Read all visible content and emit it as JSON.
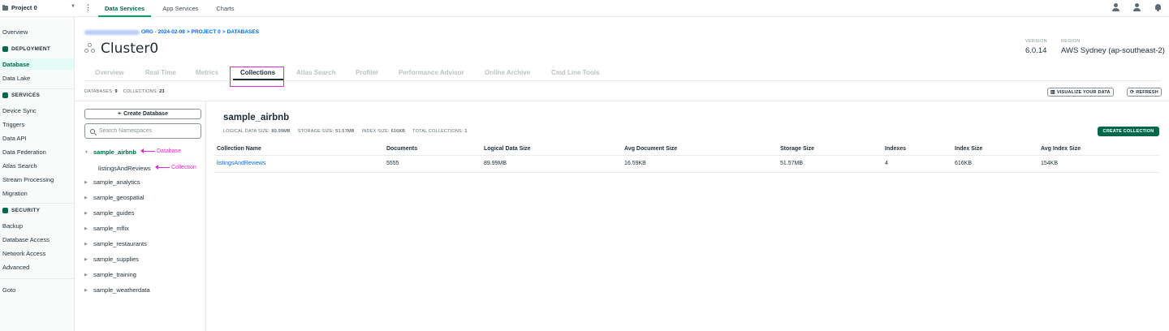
{
  "topbar": {
    "project": "Project 0",
    "tabs": [
      "Data Services",
      "App Services",
      "Charts"
    ],
    "active_tab": "Data Services"
  },
  "leftnav": {
    "overview": "Overview",
    "deployment_header": "DEPLOYMENT",
    "database": "Database",
    "data_lake": "Data Lake",
    "services_header": "SERVICES",
    "device_sync": "Device Sync",
    "triggers": "Triggers",
    "data_api": "Data API",
    "data_federation": "Data Federation",
    "atlas_search": "Atlas Search",
    "stream_processing": "Stream Processing",
    "migration": "Migration",
    "security_header": "SECURITY",
    "backup": "Backup",
    "database_access": "Database Access",
    "network_access": "Network Access",
    "advanced": "Advanced",
    "goto": "Goto"
  },
  "breadcrumb": {
    "org": "ORG - 2024-02-08",
    "sep1": ">",
    "project": "PROJECT 0",
    "sep2": ">",
    "databases": "DATABASES"
  },
  "cluster": {
    "name": "Cluster0",
    "version_label": "VERSION",
    "version": "6.0.14",
    "region_label": "REGION",
    "region": "AWS Sydney (ap-southeast-2)"
  },
  "tabs": [
    "Overview",
    "Real Time",
    "Metrics",
    "Collections",
    "Atlas Search",
    "Profiler",
    "Performance Advisor",
    "Online Archive",
    "Cmd Line Tools"
  ],
  "active_tab": "Collections",
  "counts": {
    "databases_label": "DATABASES:",
    "databases": "9",
    "collections_label": "COLLECTIONS:",
    "collections": "23"
  },
  "actions": {
    "visualize": "VISUALIZE YOUR DATA",
    "refresh": "REFRESH"
  },
  "db_panel": {
    "create_database": "Create Database",
    "search_placeholder": "Search Namespaces",
    "databases": [
      "sample_airbnb",
      "sample_analytics",
      "sample_geospatial",
      "sample_guides",
      "sample_mflix",
      "sample_restaurants",
      "sample_supplies",
      "sample_training",
      "sample_weatherdata"
    ],
    "expanded": "sample_airbnb",
    "collections": [
      "listingsAndReviews"
    ],
    "annotations": {
      "database": "Database",
      "collection": "Collection"
    }
  },
  "main": {
    "title": "sample_airbnb",
    "stats": {
      "logical_label": "LOGICAL DATA SIZE:",
      "logical": "89.99MB",
      "storage_label": "STORAGE SIZE:",
      "storage": "51.57MB",
      "index_label": "INDEX SIZE:",
      "index": "616KB",
      "total_label": "TOTAL COLLECTIONS:",
      "total": "1"
    },
    "create_collection": "CREATE COLLECTION",
    "table": {
      "headers": [
        "Collection Name",
        "Documents",
        "Logical Data Size",
        "Avg Document Size",
        "Storage Size",
        "Indexes",
        "Index Size",
        "Avg Index Size"
      ],
      "rows": [
        [
          "listingsAndReviews",
          "5555",
          "89.99MB",
          "16.59KB",
          "51.57MB",
          "4",
          "616KB",
          "154KB"
        ]
      ]
    }
  },
  "colors": {
    "accent": "#00684a",
    "accent_bright": "#00a35c",
    "link": "#016bf8",
    "annotation": "#e229c9"
  }
}
